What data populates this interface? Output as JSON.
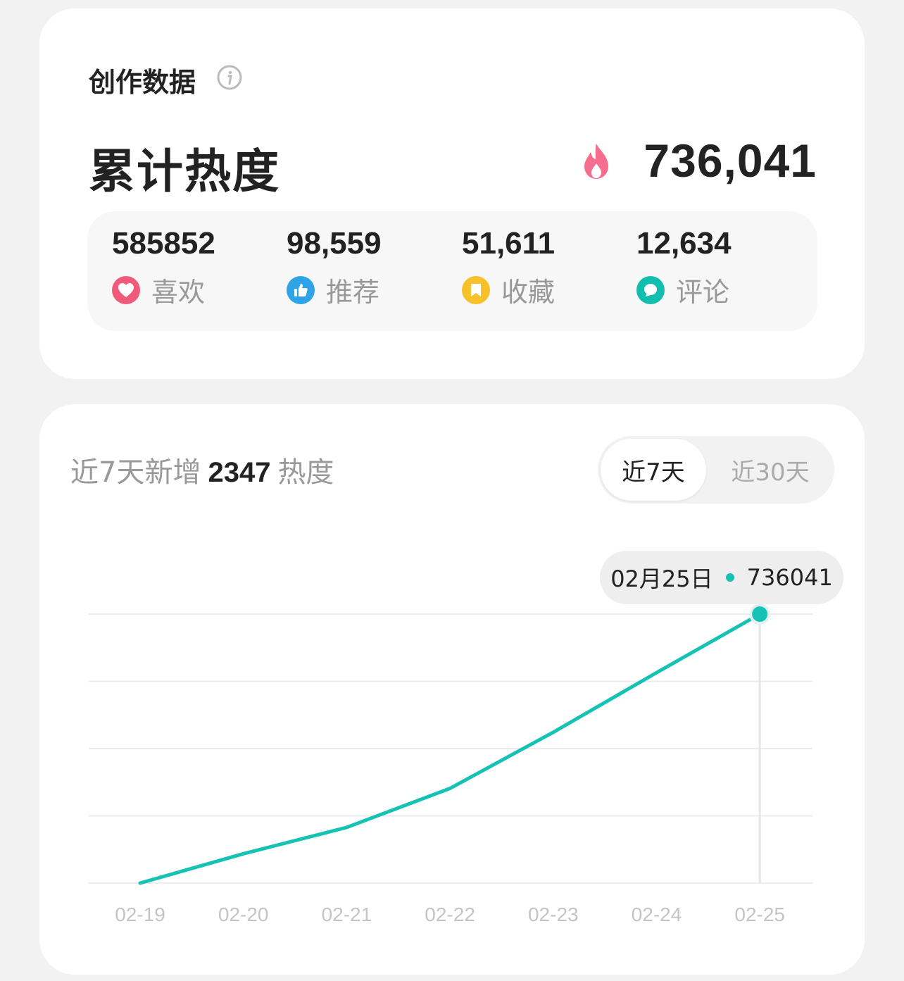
{
  "summary": {
    "section_title": "创作数据",
    "total_label": "累计热度",
    "total_value": "736,041",
    "stats": [
      {
        "value": "585852",
        "label": "喜欢",
        "icon": "heart-icon",
        "color": "#f25a7b"
      },
      {
        "value": "98,559",
        "label": "推荐",
        "icon": "thumbs-up-icon",
        "color": "#2ea3e8"
      },
      {
        "value": "51,611",
        "label": "收藏",
        "icon": "bookmark-icon",
        "color": "#f7c12b"
      },
      {
        "value": "12,634",
        "label": "评论",
        "icon": "comment-icon",
        "color": "#12bfae"
      }
    ]
  },
  "trend": {
    "title_prefix": "近7天新增",
    "title_value": "2347",
    "title_suffix": "热度",
    "tabs": [
      {
        "label": "近7天",
        "active": true
      },
      {
        "label": "近30天",
        "active": false
      }
    ],
    "tooltip": {
      "date": "02月25日",
      "value": "736041"
    }
  },
  "colors": {
    "accent": "#16c2b4",
    "flame": "#f56d8f"
  },
  "chart_data": {
    "type": "line",
    "categories": [
      "02-19",
      "02-20",
      "02-21",
      "02-22",
      "02-23",
      "02-24",
      "02-25"
    ],
    "series": [
      {
        "values": [
          733694,
          733950,
          734180,
          734520,
          735010,
          735530,
          736041
        ]
      }
    ],
    "ylim": [
      733694,
      736041
    ],
    "grid": true,
    "highlight_index": 6
  }
}
